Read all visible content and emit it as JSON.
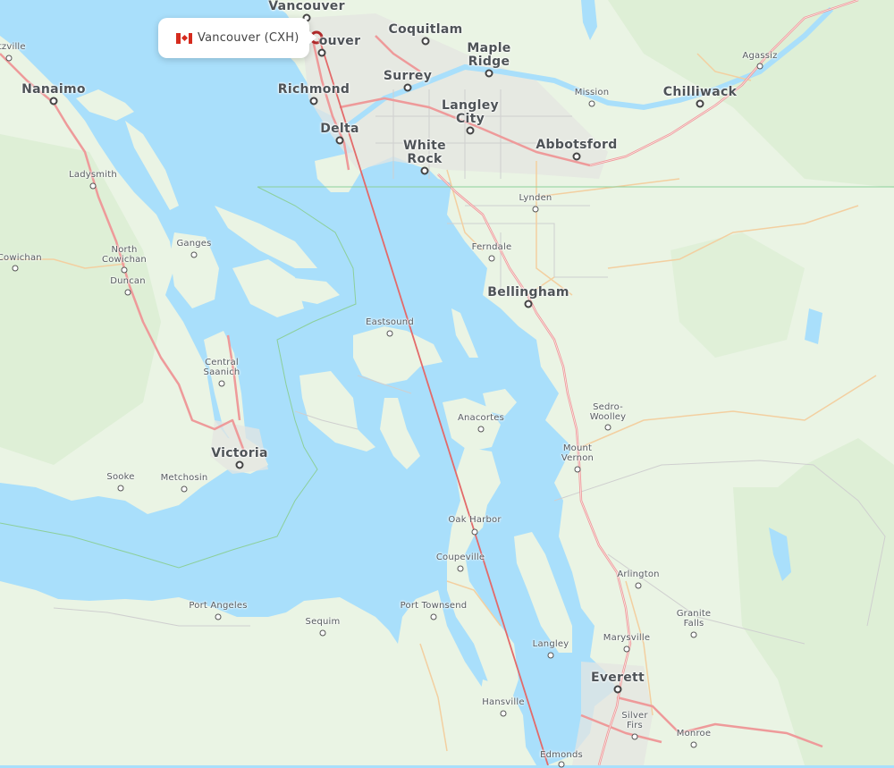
{
  "map": {
    "colors": {
      "water": "#a9dffb",
      "land": "#eaf4e4",
      "forest": "#d9ecd0",
      "urban": "#e4e6e2",
      "highway": "#ee9a9a",
      "road": "#f3cfa0",
      "minor_road": "#cfcfcf",
      "border": "#8ccf9a",
      "route": "#e36a6a"
    },
    "route": {
      "origin": "Vancouver (CXH)",
      "origin_country": "Canada",
      "origin_flag_icon": "canada-flag-icon"
    },
    "tooltip": {
      "label": "Vancouver (CXH)"
    },
    "cities_major": [
      {
        "name": "Vancouver",
        "id": "vancouver"
      },
      {
        "name": "North Vancouver",
        "id": "north-vancouver",
        "visible_text": "ouver"
      },
      {
        "name": "Coquitlam",
        "id": "coquitlam"
      },
      {
        "name": "Maple Ridge",
        "id": "maple-ridge"
      },
      {
        "name": "Nanaimo",
        "id": "nanaimo"
      },
      {
        "name": "Richmond",
        "id": "richmond"
      },
      {
        "name": "Surrey",
        "id": "surrey"
      },
      {
        "name": "Langley City",
        "id": "langley-city"
      },
      {
        "name": "Chilliwack",
        "id": "chilliwack"
      },
      {
        "name": "Delta",
        "id": "delta"
      },
      {
        "name": "White Rock",
        "id": "white-rock"
      },
      {
        "name": "Abbotsford",
        "id": "abbotsford"
      },
      {
        "name": "Bellingham",
        "id": "bellingham"
      },
      {
        "name": "Victoria",
        "id": "victoria"
      },
      {
        "name": "Everett",
        "id": "everett"
      }
    ],
    "cities_minor": [
      {
        "name": "ntzville",
        "id": "lantzville"
      },
      {
        "name": "Agassiz",
        "id": "agassiz"
      },
      {
        "name": "Mission",
        "id": "mission"
      },
      {
        "name": "Ladysmith",
        "id": "ladysmith"
      },
      {
        "name": "Lynden",
        "id": "lynden"
      },
      {
        "name": "Ganges",
        "id": "ganges"
      },
      {
        "name": "Ferndale",
        "id": "ferndale"
      },
      {
        "name": "North Cowichan",
        "id": "north-cowichan"
      },
      {
        "name": "e Cowichan",
        "id": "lake-cowichan"
      },
      {
        "name": "Duncan",
        "id": "duncan"
      },
      {
        "name": "Eastsound",
        "id": "eastsound"
      },
      {
        "name": "Central Saanich",
        "id": "central-saanich"
      },
      {
        "name": "Sedro-Woolley",
        "id": "sedro-woolley"
      },
      {
        "name": "Anacortes",
        "id": "anacortes"
      },
      {
        "name": "Mount Vernon",
        "id": "mount-vernon"
      },
      {
        "name": "Sooke",
        "id": "sooke"
      },
      {
        "name": "Metchosin",
        "id": "metchosin"
      },
      {
        "name": "Oak Harbor",
        "id": "oak-harbor"
      },
      {
        "name": "Coupeville",
        "id": "coupeville"
      },
      {
        "name": "Arlington",
        "id": "arlington"
      },
      {
        "name": "Port Angeles",
        "id": "port-angeles"
      },
      {
        "name": "Port Townsend",
        "id": "port-townsend"
      },
      {
        "name": "Sequim",
        "id": "sequim"
      },
      {
        "name": "Granite Falls",
        "id": "granite-falls"
      },
      {
        "name": "Marysville",
        "id": "marysville"
      },
      {
        "name": "Langley",
        "id": "langley"
      },
      {
        "name": "Hansville",
        "id": "hansville"
      },
      {
        "name": "Silver Firs",
        "id": "silver-firs"
      },
      {
        "name": "Monroe",
        "id": "monroe"
      },
      {
        "name": "Edmonds",
        "id": "edmonds"
      }
    ]
  }
}
